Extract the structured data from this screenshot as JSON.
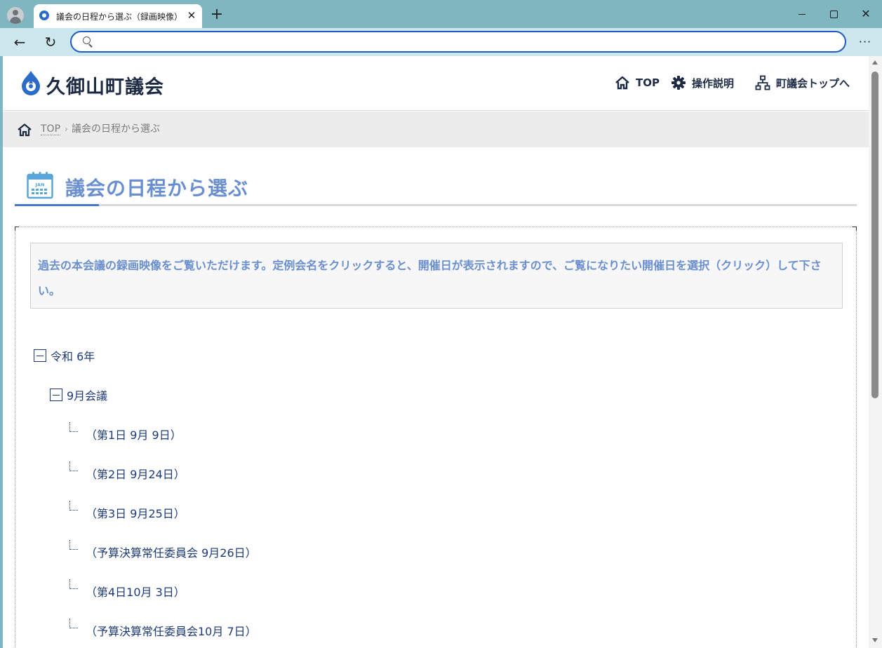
{
  "browser": {
    "tab_title": "議会の日程から選ぶ（録画映像）｜",
    "tab_close": "✕",
    "new_tab": "+",
    "window_close": "✕",
    "address_value": "",
    "menu": "···",
    "back": "←",
    "reload": "↻"
  },
  "site": {
    "title": "久御山町議会",
    "nav": [
      {
        "label": "TOP",
        "icon": "home-icon"
      },
      {
        "label": "操作説明",
        "icon": "gear-icon"
      },
      {
        "label": "町議会トップへ",
        "icon": "sitemap-icon"
      }
    ]
  },
  "breadcrumb": {
    "top": "TOP",
    "separator": "›",
    "current": "議会の日程から選ぶ"
  },
  "page": {
    "heading": "議会の日程から選ぶ",
    "calendar_icon_label": "JAN",
    "notice": "過去の本会議の録画映像をご覧いただけます。定例会名をクリックすると、開催日が表示されますので、ご覧になりたい開催日を選択（クリック）して下さい。"
  },
  "tree": {
    "year": "令和 6年",
    "session": "9月会議",
    "days": [
      "（第1日 9月 9日）",
      "（第2日 9月24日）",
      "（第3日 9月25日）",
      "（予算決算常任委員会 9月26日）",
      "（第4日10月 3日）",
      "（予算決算常任委員会10月 7日）"
    ]
  },
  "colors": {
    "accent": "#4a78c8",
    "heading_text": "#6a8fd0",
    "link": "#1c3a78",
    "chrome": "#7fb6c0"
  }
}
